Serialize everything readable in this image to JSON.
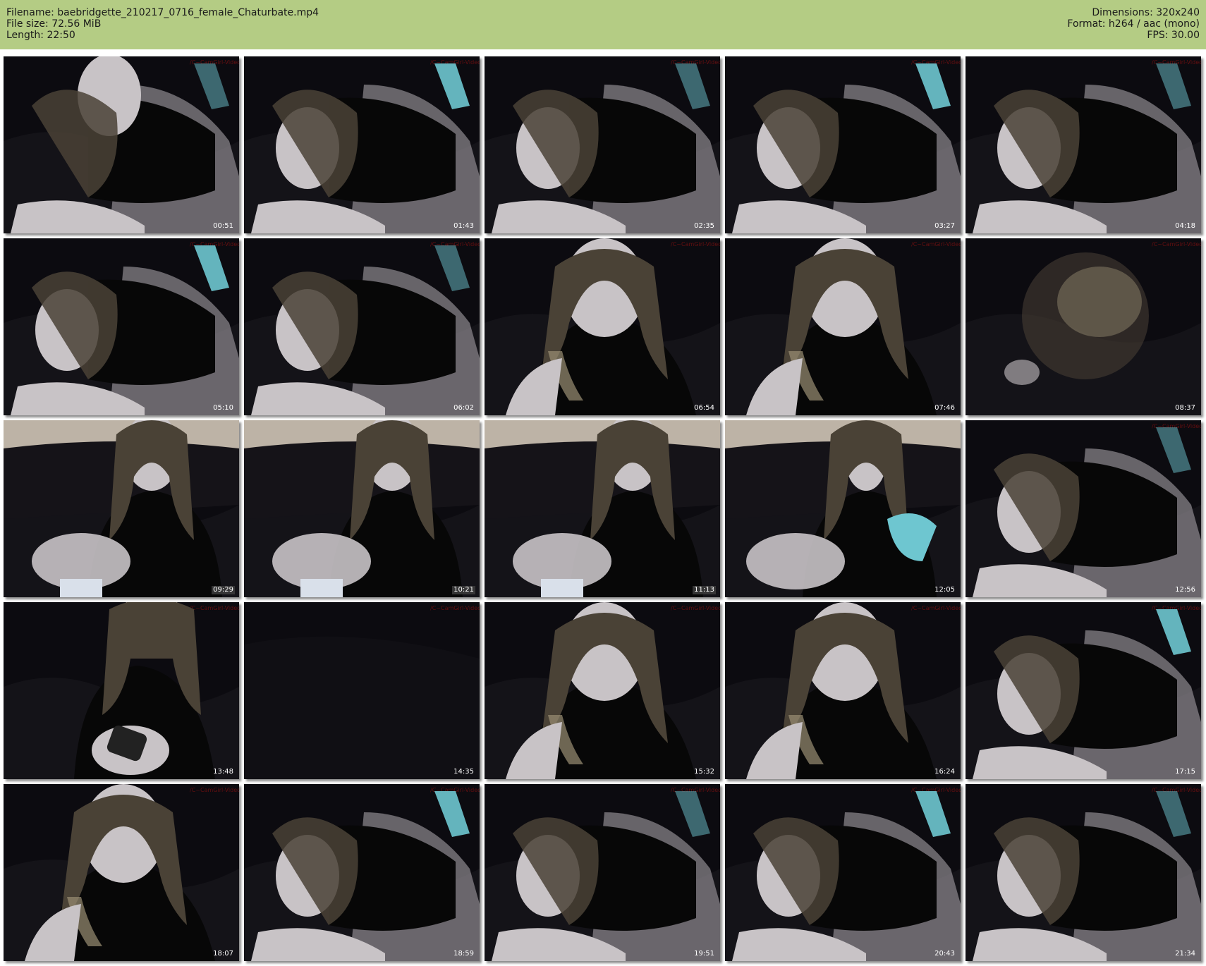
{
  "header": {
    "filename_line": "Filename: baebridgette_210217_0716_female_Chaturbate.mp4",
    "filesize_line": "File size: 72.56 MiB",
    "length_line": "Length: 22:50",
    "dimensions_line": "Dimensions: 320x240",
    "format_line": "Format: h264 / aac (mono)",
    "fps_line": "FPS: 30.00",
    "background_color": "#b4cc84"
  },
  "thumbnails": [
    {
      "time": "00:51",
      "scene": "lying-hand-face"
    },
    {
      "time": "01:43",
      "scene": "lying-side"
    },
    {
      "time": "02:35",
      "scene": "lying-side"
    },
    {
      "time": "03:27",
      "scene": "lying-side"
    },
    {
      "time": "04:18",
      "scene": "lying-side"
    },
    {
      "time": "05:10",
      "scene": "lying-side"
    },
    {
      "time": "06:02",
      "scene": "lying-side"
    },
    {
      "time": "06:54",
      "scene": "closeup"
    },
    {
      "time": "07:46",
      "scene": "closeup"
    },
    {
      "time": "08:37",
      "scene": "blur"
    },
    {
      "time": "09:29",
      "scene": "sitting"
    },
    {
      "time": "10:21",
      "scene": "sitting"
    },
    {
      "time": "11:13",
      "scene": "sitting"
    },
    {
      "time": "12:05",
      "scene": "sitting-far"
    },
    {
      "time": "12:56",
      "scene": "lying-side"
    },
    {
      "time": "13:48",
      "scene": "phone"
    },
    {
      "time": "14:35",
      "scene": "empty"
    },
    {
      "time": "15:32",
      "scene": "closeup"
    },
    {
      "time": "16:24",
      "scene": "closeup"
    },
    {
      "time": "17:15",
      "scene": "lying-side"
    },
    {
      "time": "18:07",
      "scene": "closeup"
    },
    {
      "time": "18:59",
      "scene": "lying-side"
    },
    {
      "time": "19:51",
      "scene": "lying-side"
    },
    {
      "time": "20:43",
      "scene": "lying-side"
    },
    {
      "time": "21:34",
      "scene": "lying-side"
    }
  ],
  "boxed_timestamps": [
    "09:29",
    "10:21",
    "11:13"
  ]
}
